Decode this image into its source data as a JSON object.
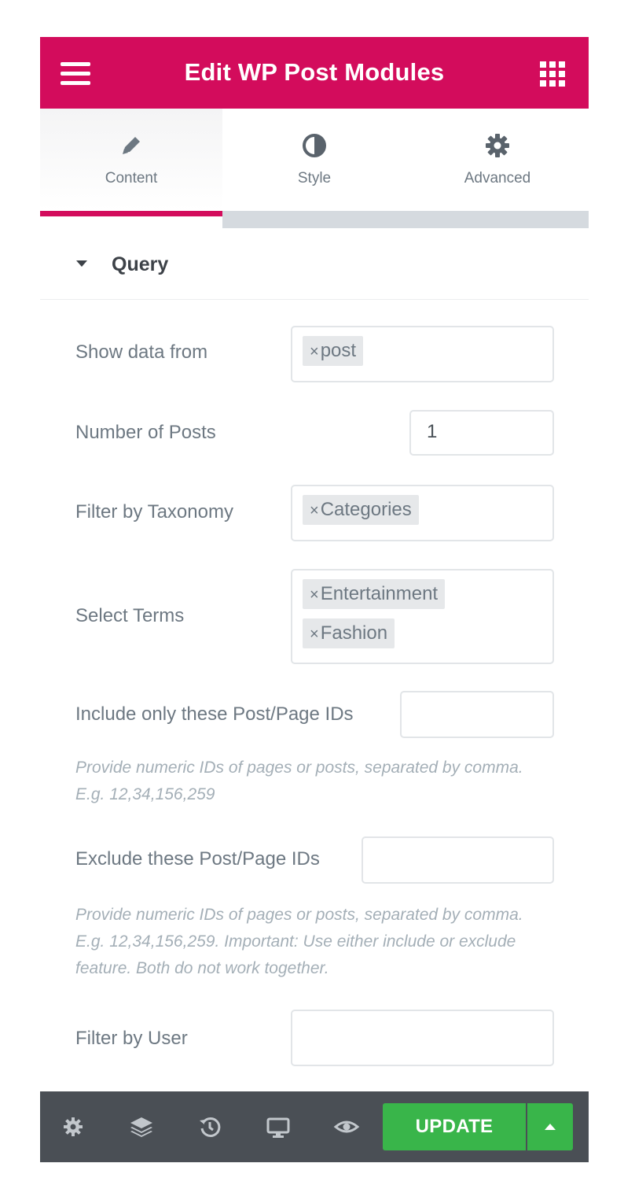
{
  "header": {
    "title": "Edit WP Post Modules",
    "menu_icon": "hamburger-menu-icon",
    "apps_icon": "grid-apps-icon",
    "background_color": "#d30c5c"
  },
  "tabs": [
    {
      "label": "Content",
      "icon": "pencil-icon",
      "active": true
    },
    {
      "label": "Style",
      "icon": "contrast-half-circle-icon",
      "active": false
    },
    {
      "label": "Advanced",
      "icon": "gear-icon",
      "active": false
    }
  ],
  "section": {
    "title": "Query",
    "expanded": true
  },
  "fields": {
    "show_data_from": {
      "label": "Show data from",
      "tags": [
        "post"
      ]
    },
    "number_of_posts": {
      "label": "Number of Posts",
      "value": "1"
    },
    "filter_by_taxonomy": {
      "label": "Filter by Taxonomy",
      "tags": [
        "Categories"
      ]
    },
    "select_terms": {
      "label": "Select Terms",
      "tags": [
        "Entertainment",
        "Fashion"
      ]
    },
    "include_ids": {
      "label": "Include only these Post/Page IDs",
      "value": "",
      "help": "Provide numeric IDs of pages or posts, separated by comma. E.g. 12,34,156,259"
    },
    "exclude_ids": {
      "label": "Exclude these Post/Page IDs",
      "value": "",
      "help": "Provide numeric IDs of pages or posts, separated by comma. E.g. 12,34,156,259. Important: Use either include or exclude feature. Both do not work together."
    },
    "filter_by_user": {
      "label": "Filter by User",
      "value": ""
    }
  },
  "tag_remove_glyph": "×",
  "footer": {
    "icons": [
      "settings-gear-icon",
      "layers-icon",
      "history-icon",
      "responsive-desktop-icon",
      "preview-eye-icon"
    ],
    "update_label": "UPDATE",
    "update_color": "#39b54a",
    "background_color": "#4a4f55"
  }
}
